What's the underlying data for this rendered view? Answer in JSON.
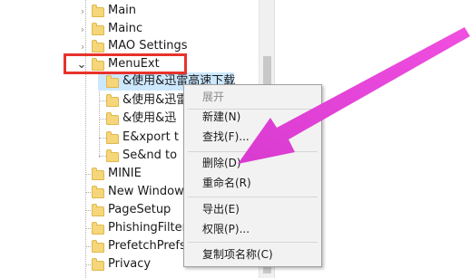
{
  "tree": {
    "items": [
      {
        "label": "Main",
        "expander": "›"
      },
      {
        "label": "Mainc",
        "expander": "›"
      },
      {
        "label": "MAO Settings",
        "expander": "›"
      },
      {
        "label": "MenuExt",
        "expander": "⌄"
      },
      {
        "label": "&使用&迅雷高速下载"
      },
      {
        "label": "&使用&迅雷"
      },
      {
        "label": "&使用&迅"
      },
      {
        "label": "E&xport t"
      },
      {
        "label": "Se&nd to"
      },
      {
        "label": "MINIE"
      },
      {
        "label": "New Window"
      },
      {
        "label": "PageSetup"
      },
      {
        "label": "PhishingFilter"
      },
      {
        "label": "PrefetchPrefs"
      },
      {
        "label": "Privacy"
      }
    ]
  },
  "context_menu": {
    "items": [
      {
        "label": "展开",
        "enabled": false
      },
      {
        "label": "新建(N)",
        "enabled": true
      },
      {
        "label": "查找(F)...",
        "enabled": true
      },
      {
        "label": "删除(D)",
        "enabled": true
      },
      {
        "label": "重命名(R)",
        "enabled": true
      },
      {
        "label": "导出(E)",
        "enabled": true
      },
      {
        "label": "权限(P)...",
        "enabled": true
      },
      {
        "label": "复制项名称(C)",
        "enabled": true
      }
    ]
  },
  "colors": {
    "highlight_box": "#e8322b",
    "annotation_arrow": "#e84ad8",
    "selection": "#cce8ff"
  },
  "icons": [
    "folder-icon",
    "chevron-right-icon",
    "chevron-down-icon"
  ]
}
